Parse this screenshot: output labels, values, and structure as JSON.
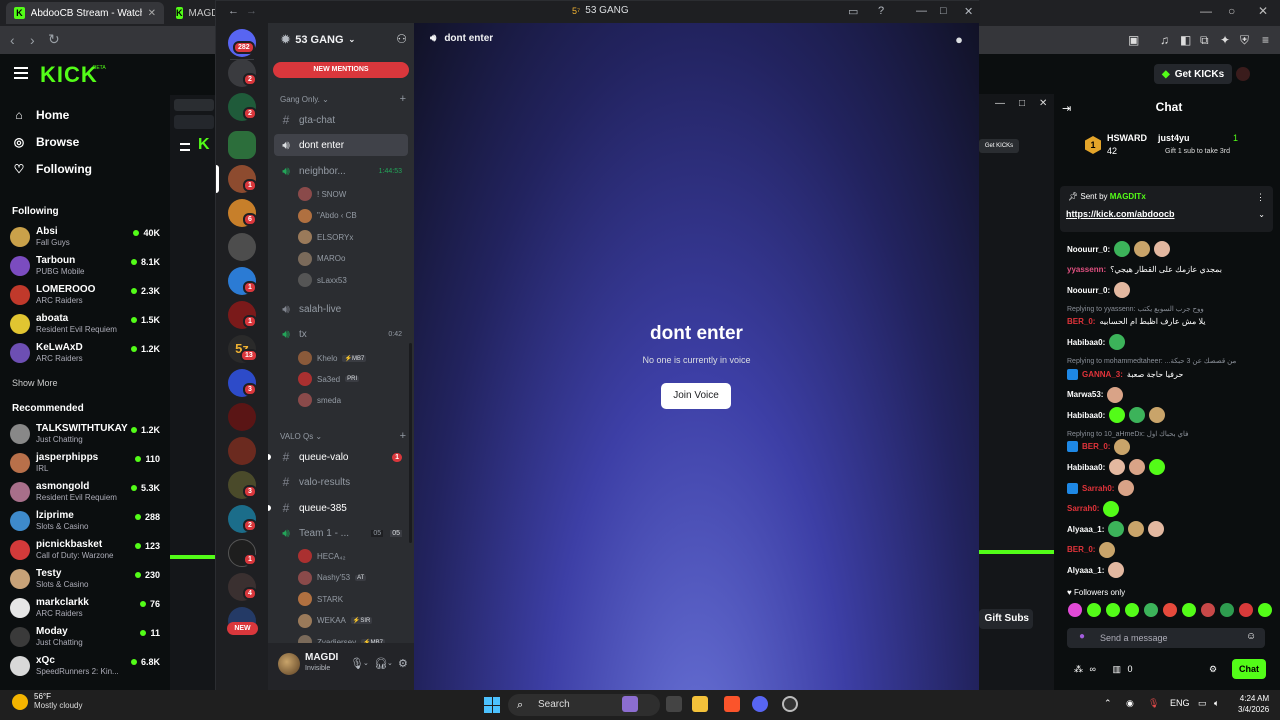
{
  "browser": {
    "tabs": [
      {
        "label": "AbdooCB Stream - Watch Live on Ki"
      },
      {
        "label": "MAGD"
      }
    ],
    "tab_close": "✕"
  },
  "kick": {
    "logo": "KICK",
    "beta": "BETA",
    "nav": [
      {
        "label": "Home",
        "icon": "home-icon"
      },
      {
        "label": "Browse",
        "icon": "browse-icon"
      },
      {
        "label": "Following",
        "icon": "heart-icon"
      }
    ],
    "following_title": "Following",
    "following": [
      {
        "name": "Absi",
        "category": "Fall Guys",
        "viewers": "40K",
        "color": "#c9a14a"
      },
      {
        "name": "Tarboun",
        "category": "PUBG Mobile",
        "viewers": "8.1K",
        "color": "#7b4cc0"
      },
      {
        "name": "LOMEROOO",
        "category": "ARC Raiders",
        "viewers": "2.3K",
        "color": "#c0392b"
      },
      {
        "name": "aboata",
        "category": "Resident Evil Requiem",
        "viewers": "1.5K",
        "color": "#e1c531"
      },
      {
        "name": "KeLwAxD",
        "category": "ARC Raiders",
        "viewers": "1.2K",
        "color": "#6d4fb3"
      }
    ],
    "show_more": "Show More",
    "recommended_title": "Recommended",
    "recommended": [
      {
        "name": "TALKSWITHTUKAY",
        "category": "Just Chatting",
        "viewers": "1.2K",
        "color": "#888888"
      },
      {
        "name": "jasperphipps",
        "category": "IRL",
        "viewers": "110",
        "color": "#b8704a"
      },
      {
        "name": "asmongold",
        "category": "Resident Evil Requiem",
        "viewers": "5.3K",
        "color": "#a86f8a"
      },
      {
        "name": "lziprime",
        "category": "Slots & Casino",
        "viewers": "288",
        "color": "#3e8acb"
      },
      {
        "name": "picnickbasket",
        "category": "Call of Duty: Warzone",
        "viewers": "123",
        "color": "#d33a3a"
      },
      {
        "name": "Testy",
        "category": "Slots & Casino",
        "viewers": "230",
        "color": "#c7a278"
      },
      {
        "name": "markclarkk",
        "category": "ARC Raiders",
        "viewers": "76",
        "color": "#e6e6e6"
      },
      {
        "name": "Moday",
        "category": "Just Chatting",
        "viewers": "11",
        "color": "#3a3a3a"
      },
      {
        "name": "xQc",
        "category": "SpeedRunners 2: Kin...",
        "viewers": "6.8K",
        "color": "#d8d8d8"
      }
    ],
    "get_kicks": "Get KICKs"
  },
  "discord": {
    "window_title": "53 GANG",
    "window_icon": "5⁷",
    "server_name": "53 GANG",
    "new_mentions": "NEW MENTIONS",
    "new_pill": "NEW",
    "guild_badges": [
      "282",
      "2",
      "2",
      "1",
      "6",
      "1",
      "1",
      "13",
      "3",
      "3",
      "2",
      "1",
      "4"
    ],
    "categories": {
      "gang": "Gang Only.",
      "valo": "VALO Qs"
    },
    "channels": {
      "gta_chat": "gta-chat",
      "dont_enter": "dont enter",
      "neighbor": "neighbor...",
      "neighbor_time": "1:44:53",
      "salah_live": "salah-live",
      "tx": "tx",
      "tx_time": "0:42",
      "queue_valo": "queue-valo",
      "queue_valo_badge": "1",
      "valo_results": "valo-results",
      "queue_385": "queue-385",
      "team1": "Team 1 - ...",
      "team1_count": "05",
      "team1_limit": "05"
    },
    "voice_users": {
      "neighbor": [
        "! SNOW",
        "\"Abdo ‹ CB",
        "ELSORYx",
        "MAROo",
        "sLaxx53"
      ],
      "tx": [
        "Khelo",
        "Sa3ed",
        "smeda"
      ],
      "team1": [
        "HECA₄₂",
        "Nashy'53",
        "STARK",
        "WEKAA",
        "Zyadjersey"
      ]
    },
    "voice_tags": {
      "khelo": "⚡MB7",
      "sa3ed": "PRI",
      "nashy": "AT",
      "wekaa": "⚡SIR",
      "zyad": "⚡MB7"
    },
    "user": {
      "name": "MAGDI",
      "status": "Invisible"
    },
    "main": {
      "channel_name": "dont enter",
      "title": "dont enter",
      "subtitle": "No one is currently in voice",
      "join_button": "Join Voice"
    }
  },
  "chat": {
    "title": "Chat",
    "leaderboard": [
      {
        "rank": "1",
        "name": "HSWARD",
        "count": "42"
      },
      {
        "name": "just4yu",
        "count": "1",
        "note": "Gift 1 sub to take 3rd"
      }
    ],
    "pinned": {
      "sent_by": "Sent by",
      "user": "MAGDITx",
      "link": "https://kick.com/abdoocb"
    },
    "messages": [
      {
        "user": "Noouurr_0:",
        "text": "",
        "color": "#ffffff"
      },
      {
        "user": "yyassenn:",
        "text": "بمجدي عازمك على القطار هيجي؟",
        "color": "#e05080"
      },
      {
        "user": "Noouurr_0:",
        "text": "",
        "color": "#ffffff"
      },
      {
        "reply": "Replying to yyassenn: ووح جرب السوبع يكتب"
      },
      {
        "user": "BER_0:",
        "text": "يلا مش عارف اظبط ام الحسابيه",
        "color": "#e0333a"
      },
      {
        "user": "Habibaa0:",
        "text": "",
        "color": "#ffffff"
      },
      {
        "reply": "Replying to mohammedtaheer: ...من قصصك عن 3 حبكة"
      },
      {
        "user": "GANNA_3:",
        "text": "حرفيا حاجة صعبة",
        "color": "#e0333a"
      },
      {
        "user": "Marwa53:",
        "text": "",
        "color": "#ffffff"
      },
      {
        "user": "Habibaa0:",
        "text": "",
        "color": "#ffffff"
      },
      {
        "reply": "Replying to 10_aHmeDx: فاي بحباك اول"
      },
      {
        "user": "BER_0:",
        "text": "",
        "color": "#e0333a"
      },
      {
        "user": "Habibaa0:",
        "text": "",
        "color": "#ffffff"
      },
      {
        "user": "Sarrah0:",
        "text": "",
        "color": "#e0333a"
      },
      {
        "user": "Sarrah0:",
        "text": "",
        "color": "#e0333a"
      },
      {
        "user": "Alyaaa_1:",
        "text": "",
        "color": "#ffffff"
      },
      {
        "user": "BER_0:",
        "text": "",
        "color": "#e0333a"
      },
      {
        "user": "Alyaaa_1:",
        "text": "",
        "color": "#ffffff"
      }
    ],
    "followers_only": "Followers only",
    "input_placeholder": "Send a message",
    "send_button": "Chat",
    "kicks_count": "0",
    "gift_subs": "Gift Subs"
  },
  "taskbar": {
    "temperature": "56°F",
    "weather": "Mostly cloudy",
    "search": "Search",
    "language": "ENG",
    "time": "4:24 AM",
    "date": "3/4/2026"
  }
}
